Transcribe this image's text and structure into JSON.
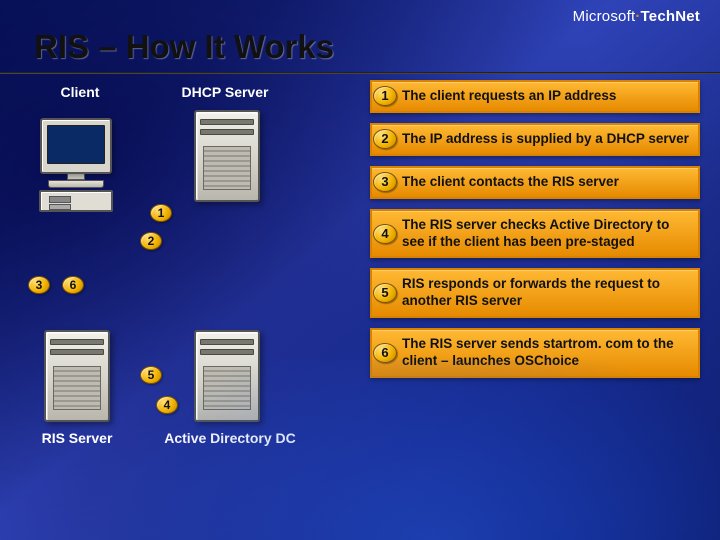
{
  "brand": {
    "prefix": "Microsoft",
    "product": "TechNet"
  },
  "title": "RIS – How It Works",
  "nodes": {
    "client": "Client",
    "dhcp": "DHCP Server",
    "ris": "RIS Server",
    "addc": "Active Directory DC"
  },
  "diagram_badges": [
    "1",
    "2",
    "3",
    "4",
    "5",
    "6"
  ],
  "steps": [
    {
      "n": "1",
      "text": "The client requests an IP address"
    },
    {
      "n": "2",
      "text": "The IP address is supplied by a DHCP server"
    },
    {
      "n": "3",
      "text": "The client contacts the RIS server"
    },
    {
      "n": "4",
      "text": "The RIS server checks Active Directory to see if the client has been pre-staged"
    },
    {
      "n": "5",
      "text": "RIS responds or forwards the request to another RIS server"
    },
    {
      "n": "6",
      "text": "The RIS server sends startrom. com to the client – launches OSChoice"
    }
  ]
}
